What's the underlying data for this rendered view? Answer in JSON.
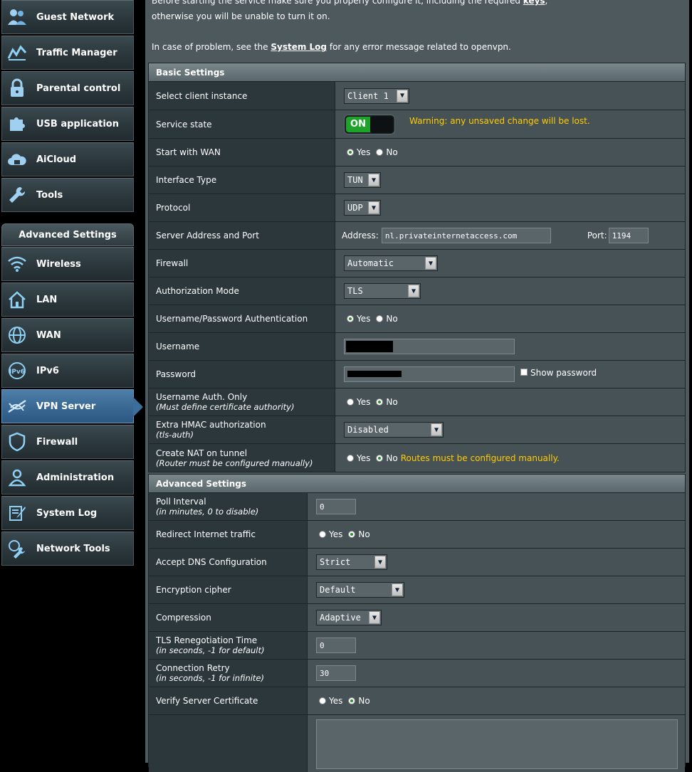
{
  "sidebar": {
    "items_top": [
      {
        "label": "Guest Network",
        "icon": "guest-network-icon"
      },
      {
        "label": "Traffic Manager",
        "icon": "traffic-manager-icon"
      },
      {
        "label": "Parental control",
        "icon": "lock-icon"
      },
      {
        "label": "USB application",
        "icon": "puzzle-icon"
      },
      {
        "label": "AiCloud",
        "icon": "cloud-icon"
      },
      {
        "label": "Tools",
        "icon": "wrench-icon"
      }
    ],
    "advanced_header": "Advanced Settings",
    "items_advanced": [
      {
        "label": "Wireless",
        "icon": "wifi-icon"
      },
      {
        "label": "LAN",
        "icon": "home-icon"
      },
      {
        "label": "WAN",
        "icon": "globe-icon"
      },
      {
        "label": "IPv6",
        "icon": "ipv6-icon"
      },
      {
        "label": "VPN Server",
        "icon": "vpn-icon",
        "active": true
      },
      {
        "label": "Firewall",
        "icon": "shield-icon"
      },
      {
        "label": "Administration",
        "icon": "person-icon"
      },
      {
        "label": "System Log",
        "icon": "log-icon"
      },
      {
        "label": "Network Tools",
        "icon": "network-tools-icon"
      }
    ]
  },
  "intro": {
    "line1_prefix": "Before starting the service make sure you properly configure it, including the required ",
    "line1_link": "keys",
    "line1_suffix": ",",
    "line2": "otherwise you will be unable to turn it on.",
    "line3_prefix": "In case of problem, see the ",
    "line3_link": "System Log",
    "line3_suffix": " for any error message related to openvpn."
  },
  "basic": {
    "header": "Basic Settings",
    "client_instance": {
      "label": "Select client instance",
      "value": "Client 1"
    },
    "service_state": {
      "label": "Service state",
      "toggle": "ON",
      "warning": "Warning: any unsaved change will be lost."
    },
    "start_with_wan": {
      "label": "Start with WAN",
      "yes": "Yes",
      "no": "No"
    },
    "interface_type": {
      "label": "Interface Type",
      "value": "TUN"
    },
    "protocol": {
      "label": "Protocol",
      "value": "UDP"
    },
    "server_address": {
      "label": "Server Address and Port",
      "address_label": "Address:",
      "address": "nl.privateinternetaccess.com",
      "port_label": "Port:",
      "port": "1194"
    },
    "firewall": {
      "label": "Firewall",
      "value": "Automatic"
    },
    "auth_mode": {
      "label": "Authorization Mode",
      "value": "TLS"
    },
    "userpass_auth": {
      "label": "Username/Password Authentication",
      "yes": "Yes",
      "no": "No"
    },
    "username": {
      "label": "Username"
    },
    "password": {
      "label": "Password",
      "show": "Show password"
    },
    "username_only": {
      "label": "Username Auth. Only",
      "sub": "(Must define certificate authority)",
      "yes": "Yes",
      "no": "No"
    },
    "hmac": {
      "label": "Extra HMAC authorization",
      "sub": "(tls-auth)",
      "value": "Disabled"
    },
    "nat": {
      "label": "Create NAT on tunnel",
      "sub": "(Router must be configured manually)",
      "yes": "Yes",
      "no": "No",
      "note": "Routes must be configured manually."
    }
  },
  "advanced": {
    "header": "Advanced Settings",
    "poll": {
      "label": "Poll Interval",
      "sub": "(in minutes, 0 to disable)",
      "value": "0"
    },
    "redirect": {
      "label": "Redirect Internet traffic",
      "yes": "Yes",
      "no": "No"
    },
    "dns": {
      "label": "Accept DNS Configuration",
      "value": "Strict"
    },
    "cipher": {
      "label": "Encryption cipher",
      "value": "Default"
    },
    "compression": {
      "label": "Compression",
      "value": "Adaptive"
    },
    "tls_reneg": {
      "label": "TLS Renegotiation Time",
      "sub": "(in seconds, -1 for default)",
      "value": "0"
    },
    "retry": {
      "label": "Connection Retry",
      "sub": "(in seconds, -1 for infinite)",
      "value": "30"
    },
    "verify": {
      "label": "Verify Server Certificate",
      "yes": "Yes",
      "no": "No"
    }
  }
}
